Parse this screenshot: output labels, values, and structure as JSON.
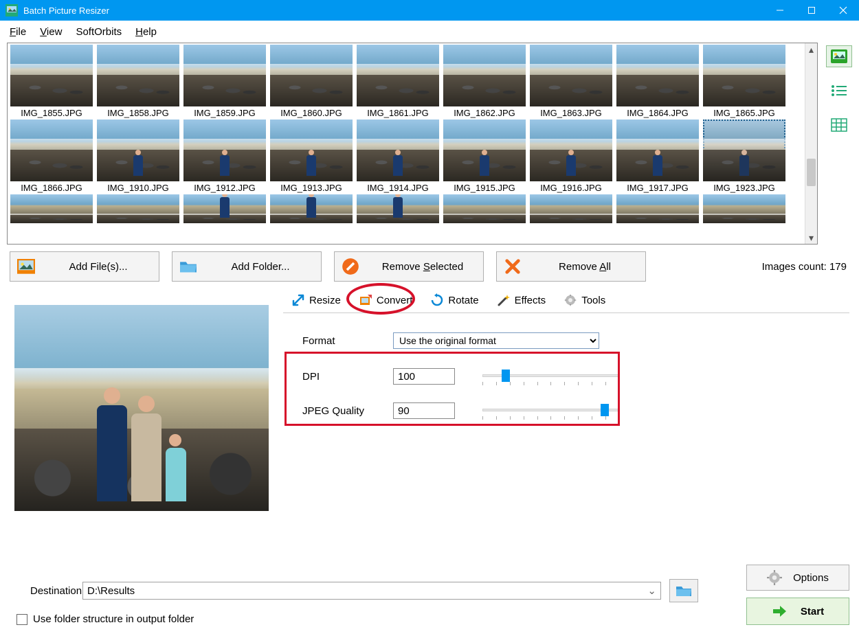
{
  "window": {
    "title": "Batch Picture Resizer"
  },
  "menu": {
    "file": "File",
    "view": "View",
    "softorbits": "SoftOrbits",
    "help": "Help"
  },
  "thumbs_row1": [
    {
      "label": "IMG_1855.JPG"
    },
    {
      "label": "IMG_1858.JPG"
    },
    {
      "label": "IMG_1859.JPG"
    },
    {
      "label": "IMG_1860.JPG"
    },
    {
      "label": "IMG_1861.JPG"
    },
    {
      "label": "IMG_1862.JPG"
    },
    {
      "label": "IMG_1863.JPG"
    },
    {
      "label": "IMG_1864.JPG"
    },
    {
      "label": "IMG_1865.JPG"
    }
  ],
  "thumbs_row2": [
    {
      "label": "IMG_1866.JPG"
    },
    {
      "label": "IMG_1910.JPG"
    },
    {
      "label": "IMG_1912.JPG"
    },
    {
      "label": "IMG_1913.JPG"
    },
    {
      "label": "IMG_1914.JPG"
    },
    {
      "label": "IMG_1915.JPG"
    },
    {
      "label": "IMG_1916.JPG"
    },
    {
      "label": "IMG_1917.JPG"
    },
    {
      "label": "IMG_1923.JPG",
      "selected": true
    }
  ],
  "actions": {
    "add_files": "Add File(s)...",
    "add_folder": "Add Folder...",
    "remove_selected": "Remove Selected",
    "remove_all": "Remove All"
  },
  "images_count_label": "Images count: 179",
  "tabs": {
    "resize": "Resize",
    "convert": "Convert",
    "rotate": "Rotate",
    "effects": "Effects",
    "tools": "Tools"
  },
  "convert": {
    "format_label": "Format",
    "format_value": "Use the original format",
    "dpi_label": "DPI",
    "dpi_value": "100",
    "jpeg_label": "JPEG Quality",
    "jpeg_value": "90"
  },
  "destination": {
    "label": "Destination",
    "value": "D:\\Results"
  },
  "use_folder_structure": "Use folder structure in output folder",
  "options_label": "Options",
  "start_label": "Start"
}
